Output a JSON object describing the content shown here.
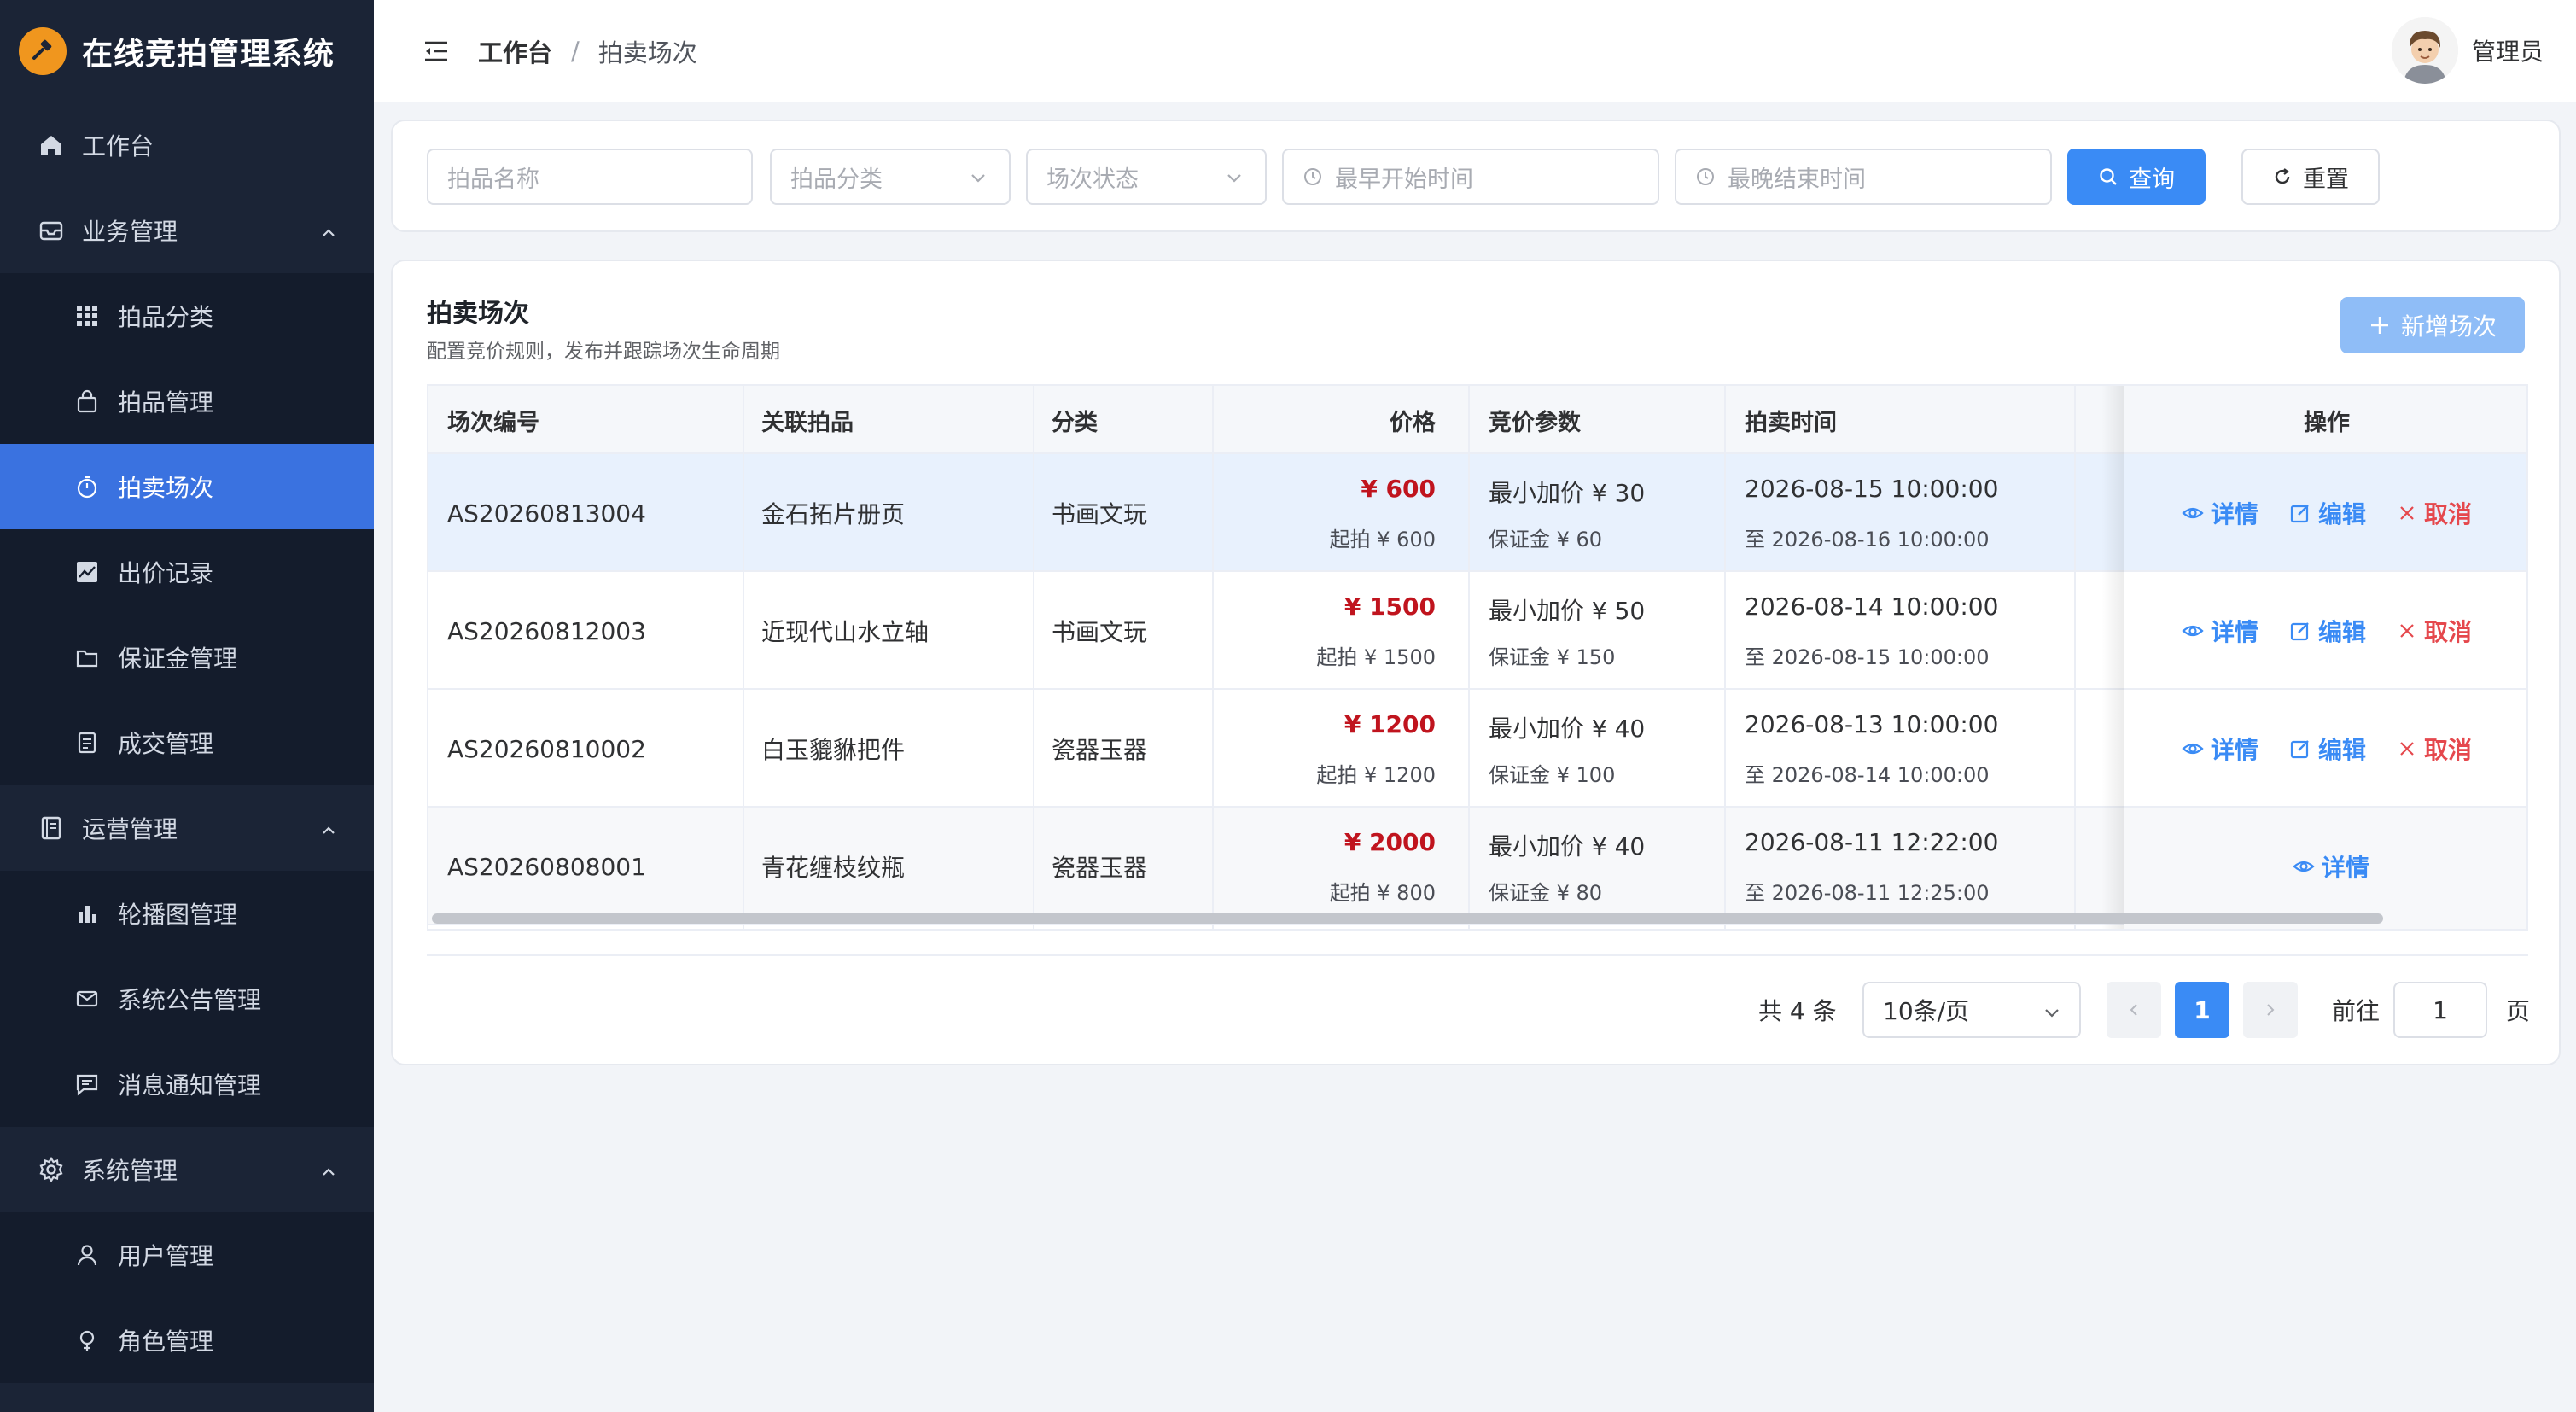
{
  "brand": {
    "title": "在线竞拍管理系统"
  },
  "sidebar": {
    "items": [
      {
        "label": "工作台"
      },
      {
        "label": "业务管理"
      },
      {
        "label": "拍品分类"
      },
      {
        "label": "拍品管理"
      },
      {
        "label": "拍卖场次"
      },
      {
        "label": "出价记录"
      },
      {
        "label": "保证金管理"
      },
      {
        "label": "成交管理"
      },
      {
        "label": "运营管理"
      },
      {
        "label": "轮播图管理"
      },
      {
        "label": "系统公告管理"
      },
      {
        "label": "消息通知管理"
      },
      {
        "label": "系统管理"
      },
      {
        "label": "用户管理"
      },
      {
        "label": "角色管理"
      }
    ]
  },
  "header": {
    "breadcrumb": [
      "工作台",
      "拍卖场次"
    ],
    "separator": "/",
    "user_name": "管理员"
  },
  "search": {
    "name_placeholder": "拍品名称",
    "category_placeholder": "拍品分类",
    "status_placeholder": "场次状态",
    "start_placeholder": "最早开始时间",
    "end_placeholder": "最晚结束时间",
    "query_label": "查询",
    "reset_label": "重置"
  },
  "section": {
    "title": "拍卖场次",
    "subtitle": "配置竞价规则，发布并跟踪场次生命周期",
    "add_label": "新增场次"
  },
  "table": {
    "columns": [
      "场次编号",
      "关联拍品",
      "分类",
      "价格",
      "竞价参数",
      "拍卖时间",
      "操作"
    ],
    "rows": [
      {
        "code": "AS20260813004",
        "item": "金石拓片册页",
        "category": "书画文玩",
        "price": "¥ 600",
        "start_price": "起拍 ¥ 600",
        "increment": "最小加价 ¥ 30",
        "deposit": "保证金 ¥ 60",
        "start_time": "2026-08-15 10:00:00",
        "end_time": "至 2026-08-16 10:00:00",
        "ops": [
          "详情",
          "编辑",
          "取消"
        ]
      },
      {
        "code": "AS20260812003",
        "item": "近现代山水立轴",
        "category": "书画文玩",
        "price": "¥ 1500",
        "start_price": "起拍 ¥ 1500",
        "increment": "最小加价 ¥ 50",
        "deposit": "保证金 ¥ 150",
        "start_time": "2026-08-14 10:00:00",
        "end_time": "至 2026-08-15 10:00:00",
        "ops": [
          "详情",
          "编辑",
          "取消"
        ]
      },
      {
        "code": "AS20260810002",
        "item": "白玉貔貅把件",
        "category": "瓷器玉器",
        "price": "¥ 1200",
        "start_price": "起拍 ¥ 1200",
        "increment": "最小加价 ¥ 40",
        "deposit": "保证金 ¥ 100",
        "start_time": "2026-08-13 10:00:00",
        "end_time": "至 2026-08-14 10:00:00",
        "ops": [
          "详情",
          "编辑",
          "取消"
        ]
      },
      {
        "code": "AS20260808001",
        "item": "青花缠枝纹瓶",
        "category": "瓷器玉器",
        "price": "¥ 2000",
        "start_price": "起拍 ¥ 800",
        "increment": "最小加价 ¥ 40",
        "deposit": "保证金 ¥ 80",
        "start_time": "2026-08-11 12:22:00",
        "end_time": "至 2026-08-11 12:25:00",
        "ops": [
          "详情"
        ]
      }
    ]
  },
  "pagination": {
    "total": "共 4 条",
    "page_size": "10条/页",
    "current_page": "1",
    "goto_label": "前往",
    "goto_value": "1",
    "page_suffix": "页"
  },
  "colors": {
    "sidebar_bg": "#1b2436",
    "active": "#3a72e0",
    "primary": "#3a8bf5",
    "price": "#c0141e",
    "danger": "#e5484d",
    "brand_logo": "#f0961e"
  }
}
